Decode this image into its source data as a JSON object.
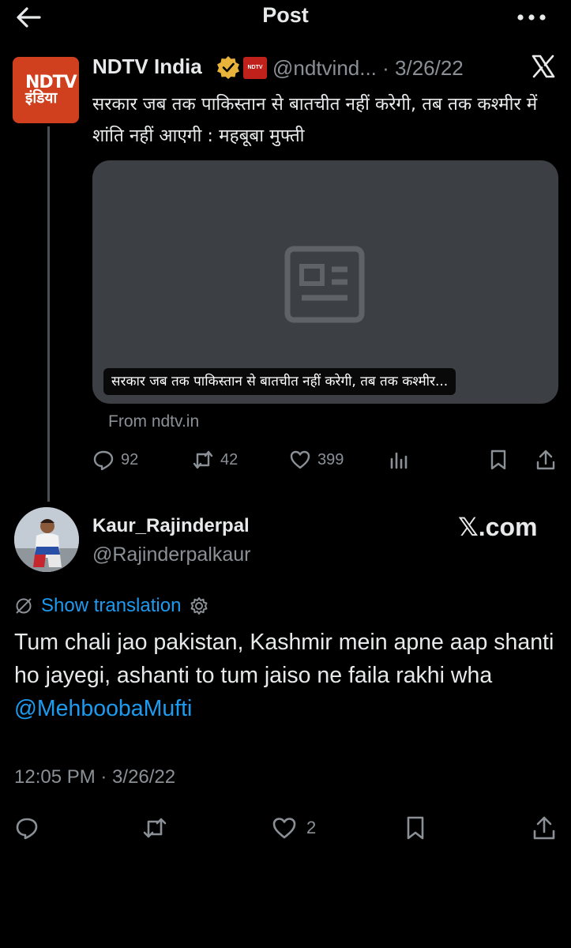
{
  "header": {
    "title": "Post",
    "back_icon": "back-arrow-icon",
    "more_icon": "more-icon"
  },
  "quoted": {
    "logo_line1": "NDTV",
    "logo_line2": "इंडिया",
    "name": "NDTV India",
    "badge": "NDTV",
    "handle_date": "@ndtvind... · 3/26/22",
    "text": "सरकार जब तक पाकिस्तान से बातचीत नहीं करेगी, तब तक कश्मीर में शांति नहीं आएगी : महबूबा मुफ्ती",
    "card_caption": "सरकार जब तक पाकिस्तान से बातचीत नहीं करेगी, तब तक कश्मीर...",
    "card_source": "From ndtv.in",
    "actions": {
      "replies": "92",
      "reposts": "42",
      "likes": "399"
    }
  },
  "main": {
    "name": "Kaur_Rajinderpal",
    "handle": "@Rajinderpalkaur",
    "site_watermark": "𝕏.com",
    "translate_label": "Show translation",
    "text": "Tum chali jao pakistan, Kashmir mein apne aap shanti ho jayegi, ashanti to tum jaiso ne faila rakhi wha ",
    "mention": "@MehboobaMufti",
    "timestamp": "12:05 PM · 3/26/22",
    "actions": {
      "likes": "2"
    }
  },
  "colors": {
    "background": "#000000",
    "text": "#e7e9ea",
    "muted": "#8b9096",
    "link": "#1d9bf0",
    "card": "#3c3f43",
    "ndtv_red": "#d0401e",
    "verified_gold": "#e8b33a"
  }
}
